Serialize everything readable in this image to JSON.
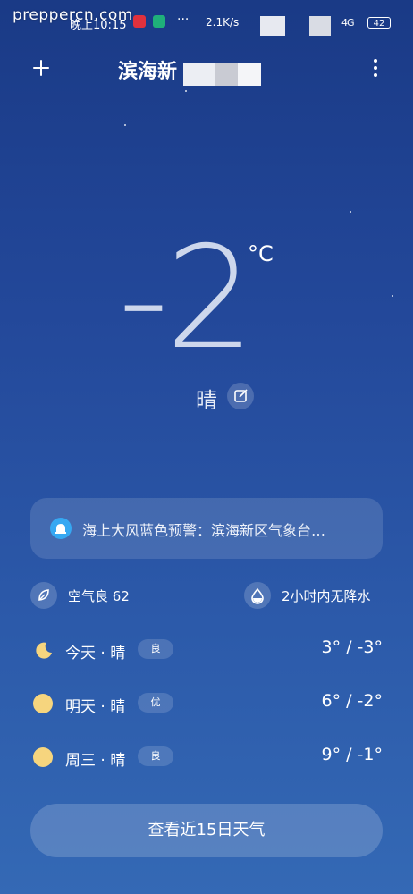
{
  "watermark": "preppercn.com",
  "status_bar": {
    "time": "晚上10:15",
    "more": "···",
    "speed": "2.1K/s",
    "signal_1": "4G",
    "battery": "42"
  },
  "header": {
    "city": "滨海新",
    "add_icon": "plus-icon",
    "more_icon": "more-vertical-icon"
  },
  "current": {
    "temperature": "-2",
    "unit": "°C",
    "condition": "晴",
    "edit_icon": "edit-icon"
  },
  "alert": {
    "text": "海上大风蓝色预警：滨海新区气象台…",
    "icon": "warning-siren-icon",
    "color": "#36a8f2"
  },
  "metrics": {
    "air_quality": {
      "label": "空气良 62",
      "icon": "leaf-icon"
    },
    "precipitation": {
      "label": "2小时内无降水",
      "icon": "raindrop-icon"
    }
  },
  "forecast": [
    {
      "day": "今天 · 晴",
      "badge": "良",
      "temps": "3° / -3°",
      "icon": "moon-icon"
    },
    {
      "day": "明天 · 晴",
      "badge": "优",
      "temps": "6° / -2°",
      "icon": "sun-icon"
    },
    {
      "day": "周三 · 晴",
      "badge": "良",
      "temps": "9° / -1°",
      "icon": "sun-icon"
    }
  ],
  "more_days_button": "查看近15日天气",
  "colors": {
    "background_top": "#1a3a86",
    "background_bottom": "#3469b5",
    "sun": "#f6d57e"
  }
}
